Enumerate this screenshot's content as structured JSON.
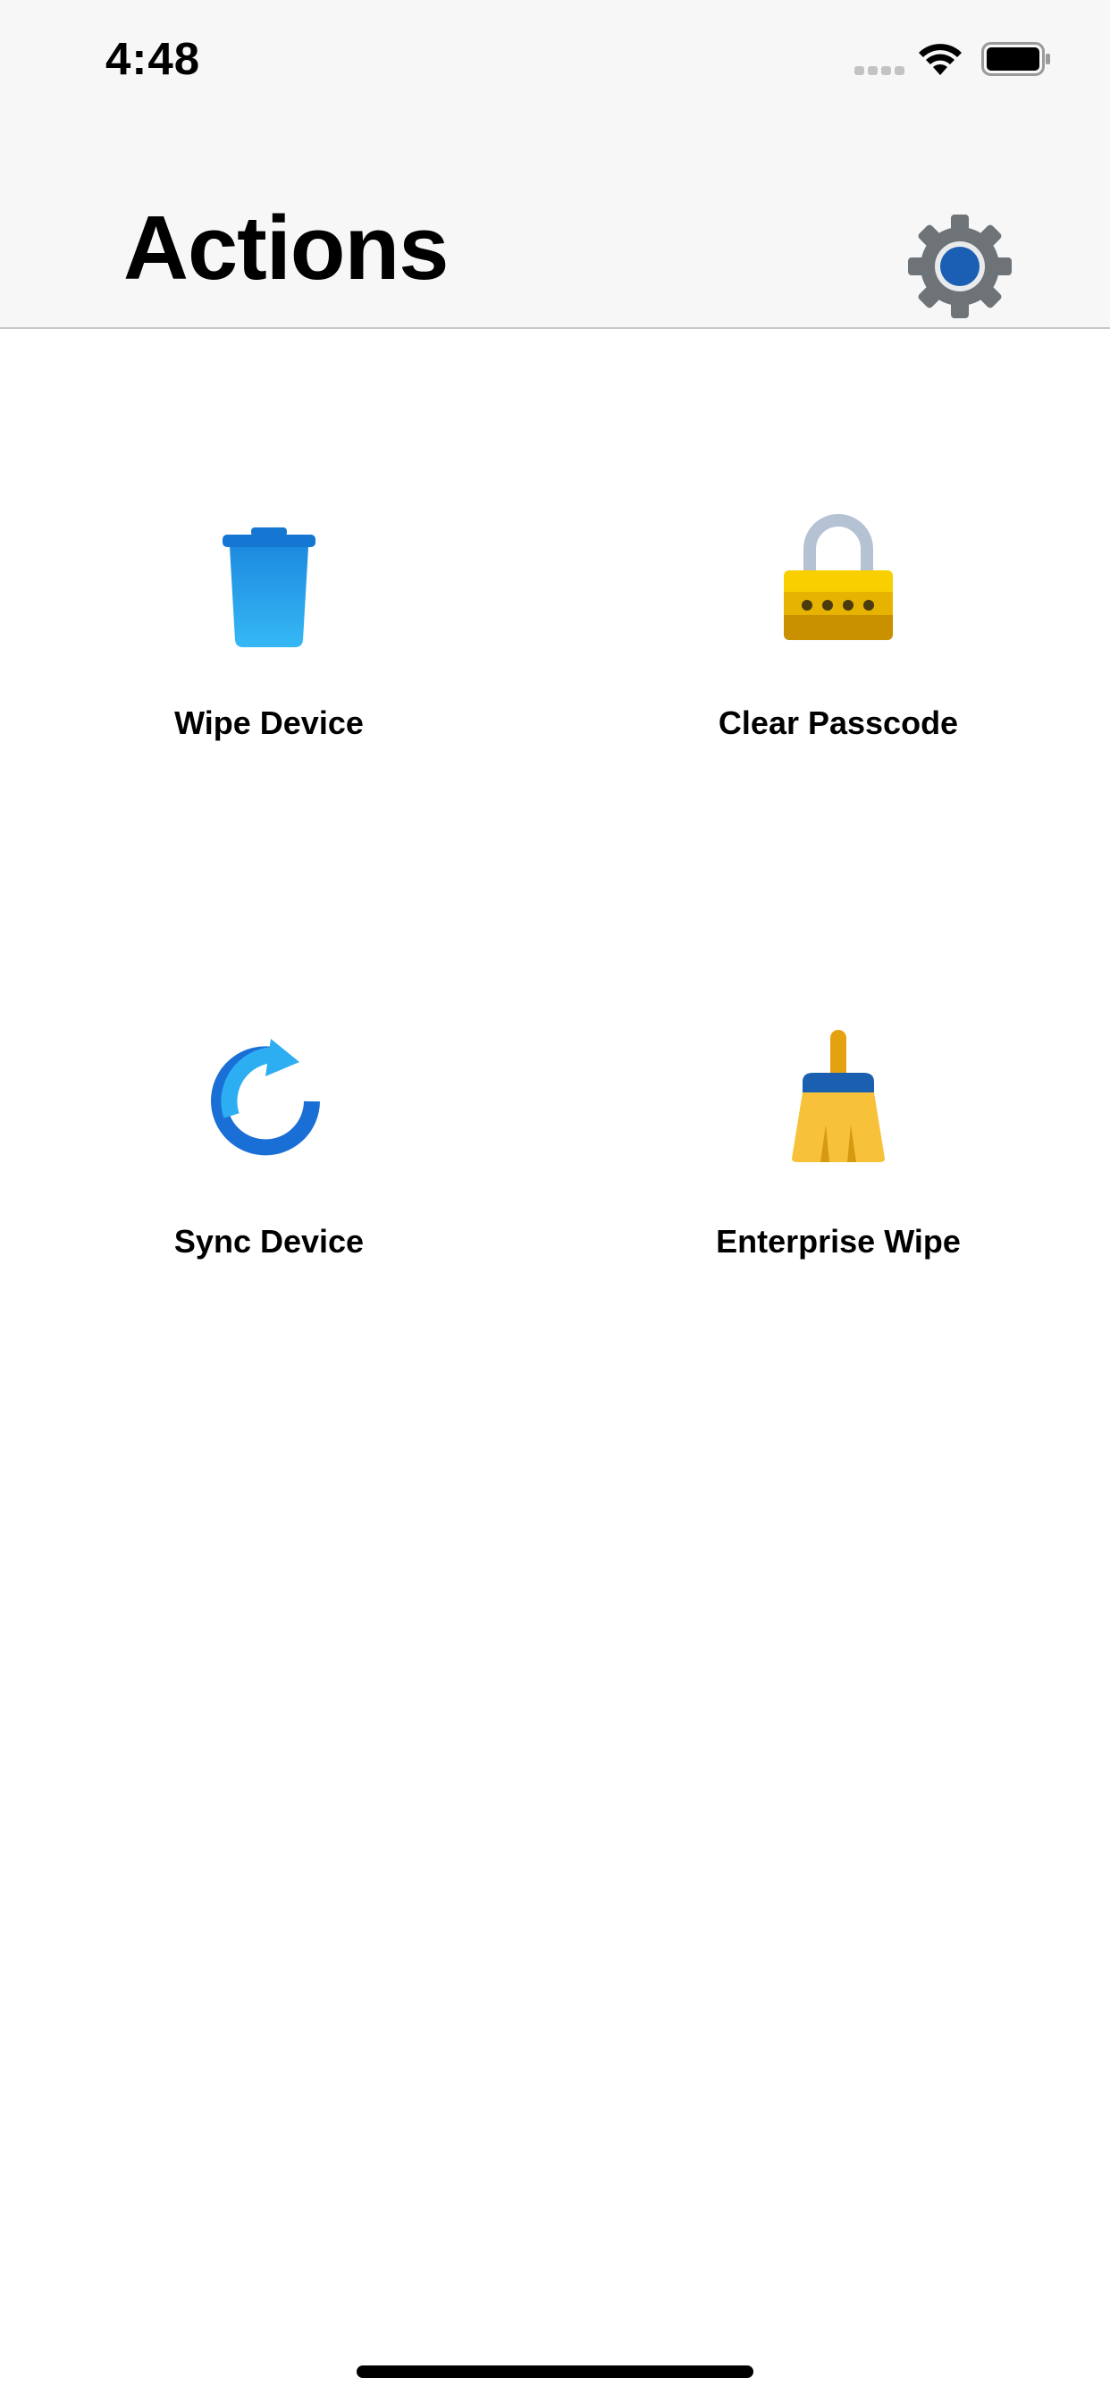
{
  "status_bar": {
    "time": "4:48"
  },
  "header": {
    "title": "Actions",
    "settings_icon": "gear-icon"
  },
  "actions": [
    {
      "label": "Wipe Device",
      "icon": "trash-icon"
    },
    {
      "label": "Clear Passcode",
      "icon": "padlock-icon"
    },
    {
      "label": "Sync Device",
      "icon": "sync-icon"
    },
    {
      "label": "Enterprise Wipe",
      "icon": "broom-icon"
    }
  ],
  "colors": {
    "nav_background": "#f7f7f7",
    "accent_blue": "#1a73d9",
    "light_blue": "#29b6f6",
    "yellow": "#f5c518",
    "gear_gray": "#6e7378"
  }
}
